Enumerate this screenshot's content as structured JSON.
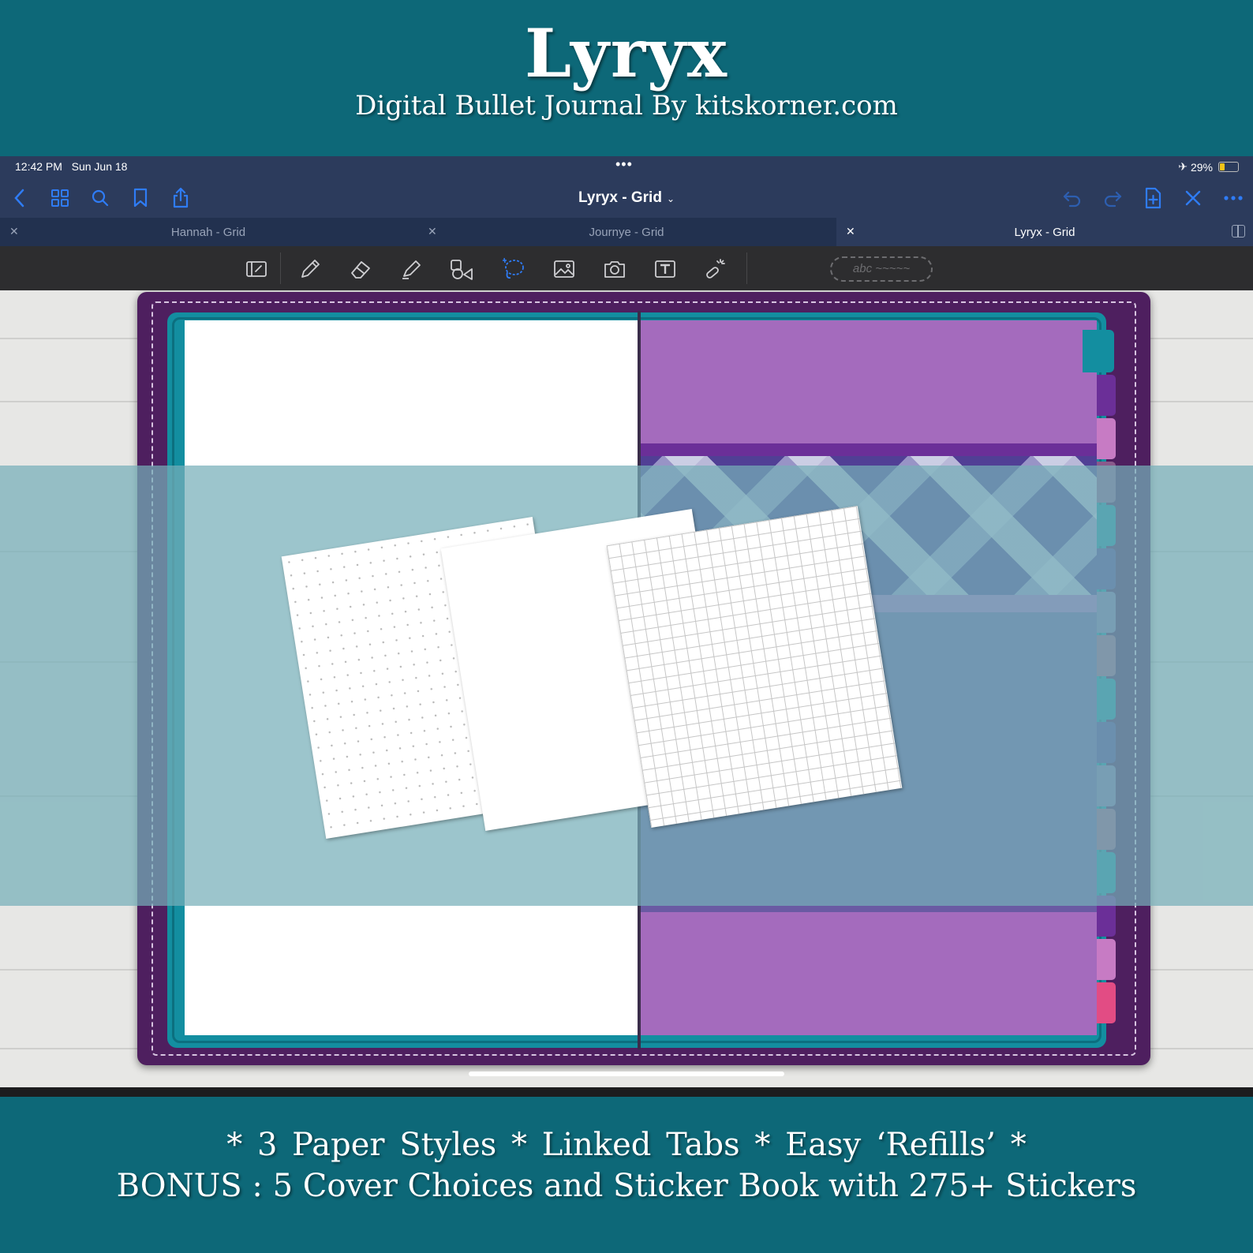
{
  "promo": {
    "title": "Lyryx",
    "subtitle": "Digital Bullet Journal By kitskorner.com",
    "features": "*  3 Paper Styles  *  Linked Tabs  *  Easy ‘Refills’  *",
    "bonus": "BONUS : 5 Cover Choices and Sticker Book with 275+ Stickers"
  },
  "status_bar": {
    "time": "12:42 PM",
    "date": "Sun Jun 18",
    "multitask_dots": "•••",
    "battery_percent": "29%",
    "battery_level": 0.29
  },
  "nav": {
    "title": "Lyryx - Grid",
    "left_icons": [
      "back-icon",
      "grid-icon",
      "search-icon",
      "bookmark-icon",
      "share-icon"
    ],
    "right_icons": [
      "undo-icon",
      "redo-icon",
      "add-page-icon",
      "close-icon",
      "more-icon"
    ]
  },
  "tabs": [
    {
      "label": "Hannah - Grid",
      "active": false
    },
    {
      "label": "Journye - Grid",
      "active": false
    },
    {
      "label": "Lyryx - Grid",
      "active": true
    }
  ],
  "toolbar": {
    "tools": [
      "sidebar-toggle-icon",
      "pen-icon",
      "eraser-icon",
      "highlighter-icon",
      "shapes-icon",
      "lasso-icon",
      "image-icon",
      "camera-icon",
      "text-icon",
      "laser-pointer-icon"
    ],
    "pen_preview": "abc ~~~~~"
  },
  "colors": {
    "banner": "#0d6878",
    "nav_bg": "#2c3b5c",
    "accent": "#2f7cf6",
    "cover_purple": "#4e1f5f",
    "cover_teal": "#138ea0",
    "page_purple": "#a46bbd"
  },
  "side_tabs": [
    "#138ea0",
    "#6b2f98",
    "#c77bc4",
    "#8a5a8c",
    "#138ea0",
    "#4f3f92",
    "#7e72aa",
    "#9a5b85",
    "#138ea0",
    "#4f3f92",
    "#7e72aa",
    "#9a5b85",
    "#138ea0",
    "#6b2f98",
    "#c77bc4",
    "#e24c84"
  ],
  "paper_styles": [
    "dot",
    "blank",
    "grid"
  ]
}
